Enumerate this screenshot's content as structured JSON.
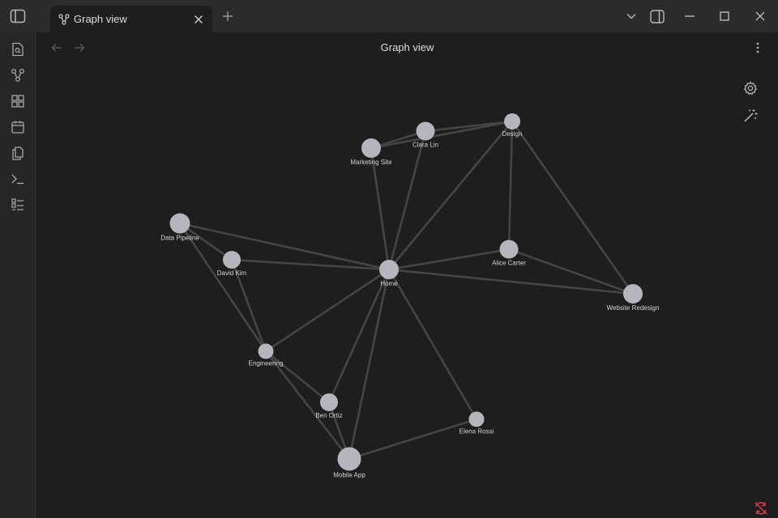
{
  "tab": {
    "label": "Graph view"
  },
  "view": {
    "title": "Graph view"
  },
  "icons": {
    "sidebar_toggle": "sidebar-left-icon",
    "graph": "graph-icon",
    "close": "close-icon",
    "new_tab": "plus-icon",
    "dropdown": "chevron-down-icon",
    "right_sidebar": "sidebar-right-icon",
    "minimize": "minimize-icon",
    "maximize": "maximize-icon",
    "window_close": "close-icon",
    "back": "arrow-left-icon",
    "forward": "arrow-right-icon",
    "more": "more-vertical-icon",
    "settings": "gear-icon",
    "animate": "magic-wand-icon",
    "sync": "sync-off-icon"
  },
  "ribbon": [
    {
      "name": "quick-switcher",
      "icon": "search-file-icon"
    },
    {
      "name": "graph-view",
      "icon": "graph-icon"
    },
    {
      "name": "canvas",
      "icon": "canvas-icon"
    },
    {
      "name": "daily-note",
      "icon": "calendar-icon"
    },
    {
      "name": "templates",
      "icon": "copy-icon"
    },
    {
      "name": "command-palette",
      "icon": "terminal-icon"
    },
    {
      "name": "bases",
      "icon": "list-icon"
    }
  ],
  "colors": {
    "background": "#1e1e1e",
    "node": "#b5b5bd",
    "edge": "#454545",
    "accent_error": "#e0404a"
  },
  "graph": {
    "nodes": [
      {
        "id": "home",
        "label": "Home"
      },
      {
        "id": "marketing",
        "label": "Marketing Site"
      },
      {
        "id": "clara",
        "label": "Clara Lin"
      },
      {
        "id": "design",
        "label": "Design"
      },
      {
        "id": "pipeline",
        "label": "Data Pipeline"
      },
      {
        "id": "david",
        "label": "David Kim"
      },
      {
        "id": "alice",
        "label": "Alice Carter"
      },
      {
        "id": "website",
        "label": "Website Redesign"
      },
      {
        "id": "engineering",
        "label": "Engineering"
      },
      {
        "id": "ben",
        "label": "Ben Ortiz"
      },
      {
        "id": "elena",
        "label": "Elena Rossi"
      },
      {
        "id": "mobile",
        "label": "Mobile App"
      }
    ],
    "edges": [
      [
        "marketing",
        "clara"
      ],
      [
        "marketing",
        "design"
      ],
      [
        "clara",
        "design"
      ],
      [
        "marketing",
        "home"
      ],
      [
        "clara",
        "home"
      ],
      [
        "design",
        "home"
      ],
      [
        "design",
        "alice"
      ],
      [
        "design",
        "website"
      ],
      [
        "pipeline",
        "home"
      ],
      [
        "pipeline",
        "david"
      ],
      [
        "pipeline",
        "engineering"
      ],
      [
        "david",
        "home"
      ],
      [
        "david",
        "engineering"
      ],
      [
        "home",
        "alice"
      ],
      [
        "home",
        "website"
      ],
      [
        "alice",
        "website"
      ],
      [
        "home",
        "engineering"
      ],
      [
        "home",
        "ben"
      ],
      [
        "home",
        "mobile"
      ],
      [
        "home",
        "elena"
      ],
      [
        "engineering",
        "ben"
      ],
      [
        "engineering",
        "mobile"
      ],
      [
        "ben",
        "mobile"
      ],
      [
        "mobile",
        "elena"
      ]
    ]
  }
}
